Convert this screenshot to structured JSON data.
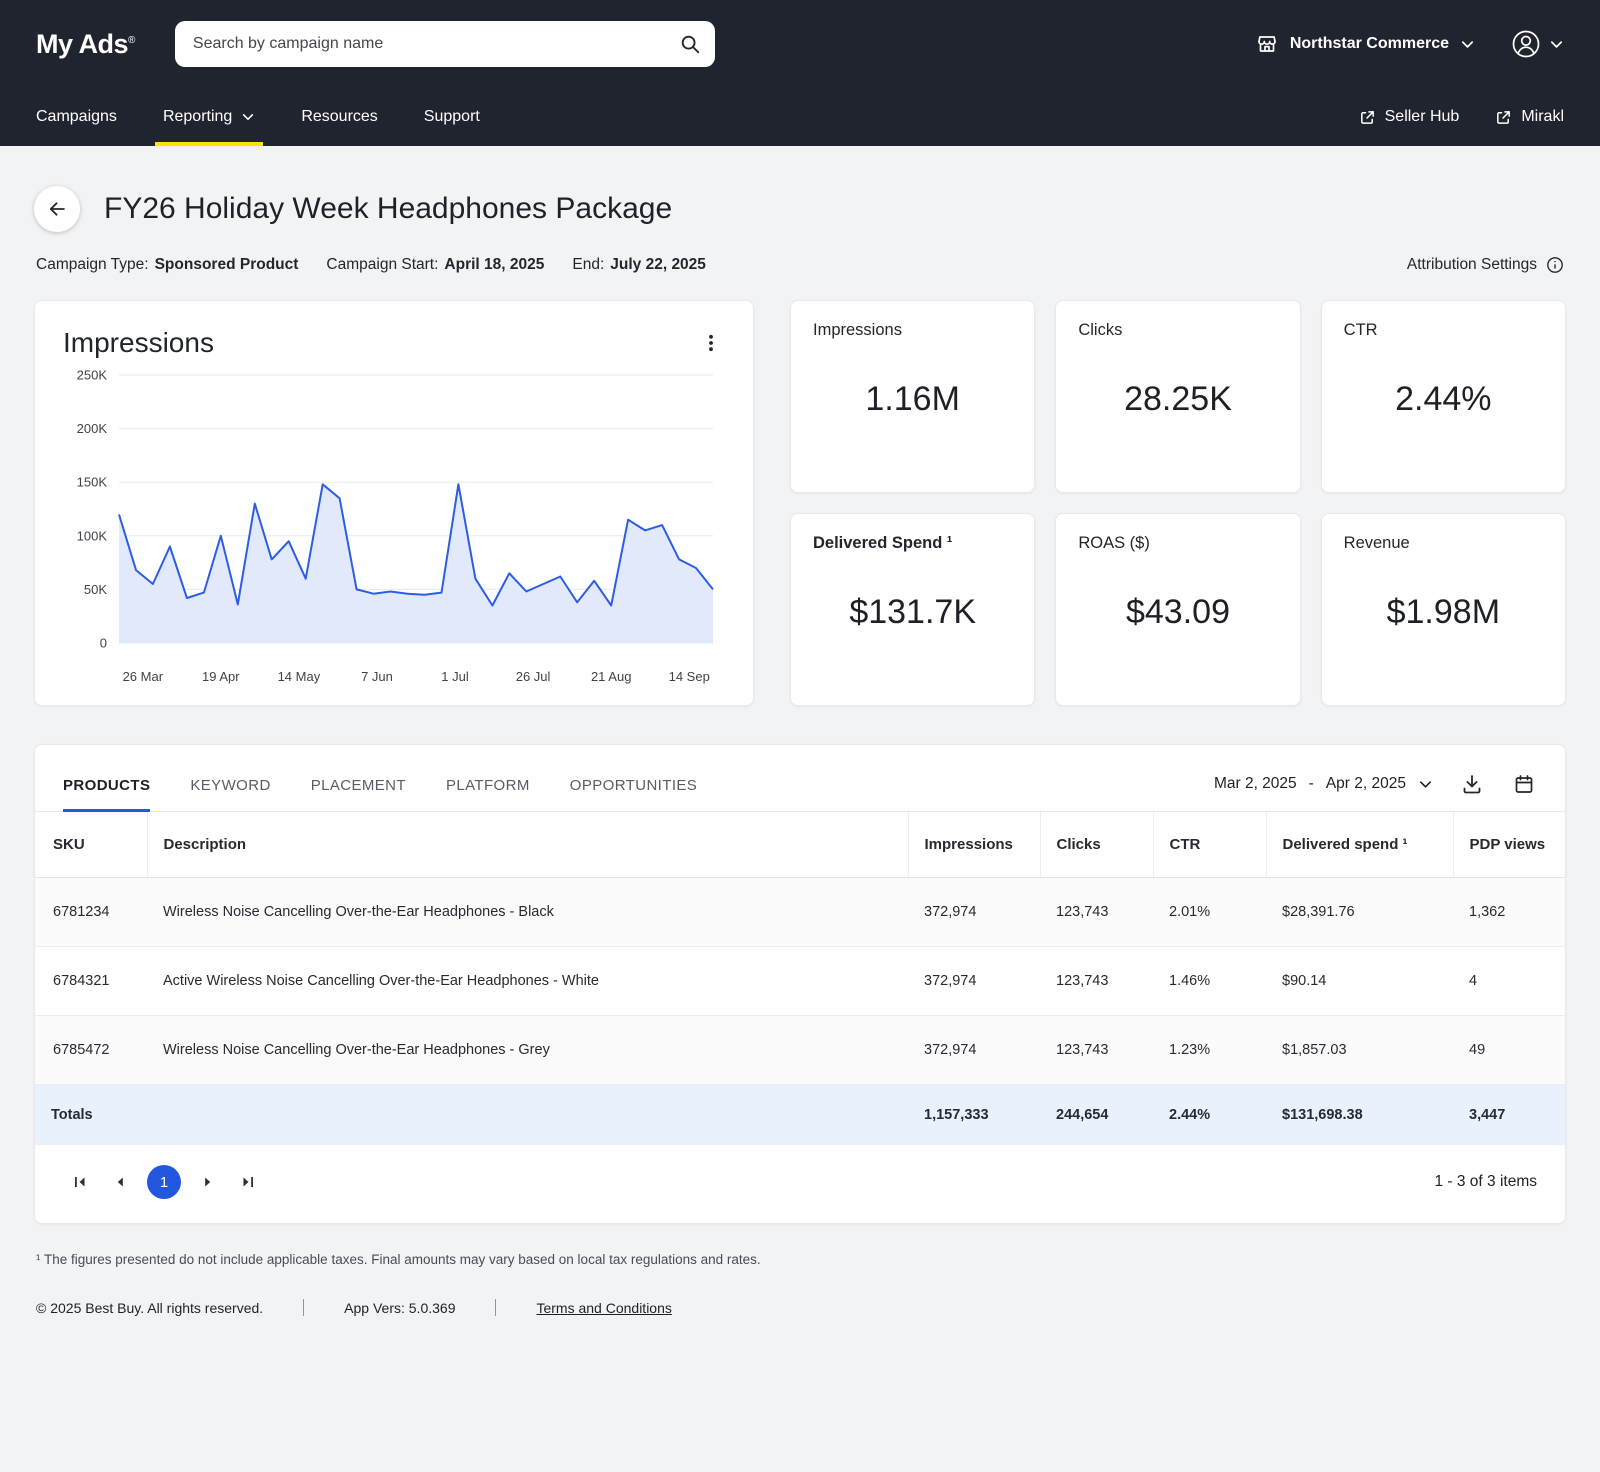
{
  "header": {
    "logo_text": "My Ads",
    "logo_reg": "®",
    "search_placeholder": "Search by campaign name",
    "account_name": "Northstar Commerce"
  },
  "nav": {
    "items": [
      {
        "label": "Campaigns"
      },
      {
        "label": "Reporting"
      },
      {
        "label": "Resources"
      },
      {
        "label": "Support"
      }
    ],
    "external_links": [
      {
        "label": "Seller Hub"
      },
      {
        "label": "Mirakl"
      }
    ]
  },
  "page": {
    "title": "FY26 Holiday Week Headphones Package",
    "meta": [
      {
        "label": "Campaign Type:",
        "value": "Sponsored Product"
      },
      {
        "label": "Campaign Start:",
        "value": "April 18, 2025"
      },
      {
        "label": "End:",
        "value": "July 22, 2025"
      }
    ],
    "attribution_settings": "Attribution Settings"
  },
  "chart_data": {
    "type": "line",
    "title": "Impressions",
    "x_spacing": "even-weekly",
    "values": [
      120000,
      68000,
      55000,
      90000,
      42000,
      47000,
      100000,
      36000,
      130000,
      78000,
      95000,
      60000,
      148000,
      135000,
      50000,
      46000,
      48000,
      46000,
      45000,
      47000,
      148000,
      60000,
      35000,
      65000,
      48000,
      55000,
      62000,
      38000,
      58000,
      35000,
      115000,
      105000,
      110000,
      78000,
      70000,
      50000
    ],
    "x_ticks": [
      "26 Mar",
      "19 Apr",
      "14 May",
      "7 Jun",
      "1 Jul",
      "26 Jul",
      "21 Aug",
      "14 Sep"
    ],
    "y_ticks": [
      "0",
      "50K",
      "100K",
      "150K",
      "200K",
      "250K"
    ],
    "ylim": [
      0,
      250000
    ],
    "grid": "horizontal",
    "legend": "none",
    "line_color": "#2d5de3",
    "fill_color": "#e2e9fb"
  },
  "kpis": [
    {
      "label": "Impressions",
      "value": "1.16M"
    },
    {
      "label": "Clicks",
      "value": "28.25K"
    },
    {
      "label": "CTR",
      "value": "2.44%"
    },
    {
      "label": "Delivered Spend ¹",
      "value": "$131.7K"
    },
    {
      "label": "ROAS ($)",
      "value": "$43.09"
    },
    {
      "label": "Revenue",
      "value": "$1.98M"
    }
  ],
  "table": {
    "tabs": [
      {
        "label": "PRODUCTS",
        "active": true
      },
      {
        "label": "KEYWORD",
        "active": false
      },
      {
        "label": "PLACEMENT",
        "active": false
      },
      {
        "label": "PLATFORM",
        "active": false
      },
      {
        "label": "OPPORTUNITIES",
        "active": false
      }
    ],
    "date_range": {
      "start": "Mar 2, 2025",
      "separator": "-",
      "end": "Apr 2, 2025"
    },
    "columns": [
      "SKU",
      "Description",
      "Impressions",
      "Clicks",
      "CTR",
      "Delivered spend ¹",
      "PDP views"
    ],
    "rows": [
      [
        "6781234",
        "Wireless Noise Cancelling Over-the-Ear Headphones - Black",
        "372,974",
        "123,743",
        "2.01%",
        "$28,391.76",
        "1,362"
      ],
      [
        "6784321",
        "Active Wireless Noise Cancelling Over-the-Ear Headphones - White",
        "372,974",
        "123,743",
        "1.46%",
        "$90.14",
        "4"
      ],
      [
        "6785472",
        "Wireless Noise Cancelling Over-the-Ear Headphones - Grey",
        "372,974",
        "123,743",
        "1.23%",
        "$1,857.03",
        "49"
      ]
    ],
    "totals": [
      "Totals",
      "1,157,333",
      "244,654",
      "2.44%",
      "$131,698.38",
      "3,447"
    ],
    "pagination": {
      "current_page": "1",
      "range_text": "1 - 3 of 3 items"
    }
  },
  "footnote": "¹ The figures presented do not include applicable taxes. Final amounts may vary based on local tax regulations and rates.",
  "footer": {
    "copyright": "© 2025 Best Buy. All rights reserved.",
    "app_version": "App Vers: 5.0.369",
    "terms_link": "Terms and Conditions"
  },
  "colors": {
    "header_bg": "#20242e",
    "nav_active_underline": "#ffe300",
    "accent_blue": "#2457e0",
    "totals_row_bg": "#e9f2fc",
    "page_bg": "#f2f3f5"
  }
}
